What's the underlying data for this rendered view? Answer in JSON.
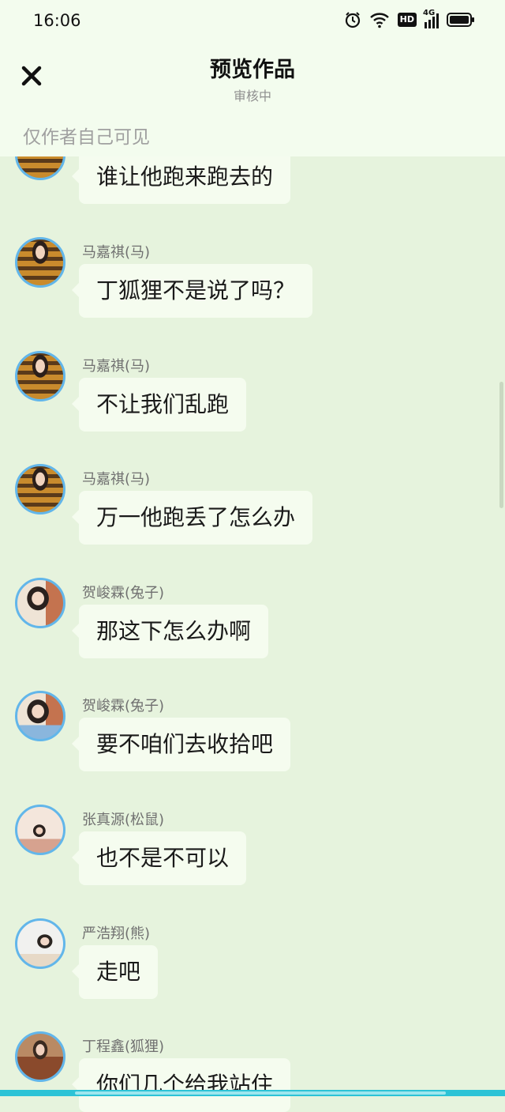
{
  "status_bar": {
    "time": "16:06",
    "hd_badge": "HD",
    "network_label": "4G"
  },
  "header": {
    "title": "预览作品",
    "subtitle": "审核中",
    "visibility_note": "仅作者自己可见",
    "close_icon": "close-icon"
  },
  "messages": [
    {
      "sender": "",
      "text": "谁让他跑来跑去的",
      "avatar": "ma"
    },
    {
      "sender": "马嘉祺(马)",
      "text": "丁狐狸不是说了吗？",
      "avatar": "ma"
    },
    {
      "sender": "马嘉祺(马)",
      "text": "不让我们乱跑",
      "avatar": "ma"
    },
    {
      "sender": "马嘉祺(马)",
      "text": "万一他跑丢了怎么办",
      "avatar": "ma"
    },
    {
      "sender": "贺峻霖(兔子)",
      "text": "那这下怎么办啊",
      "avatar": "he"
    },
    {
      "sender": "贺峻霖(兔子)",
      "text": "要不咱们去收拾吧",
      "avatar": "he"
    },
    {
      "sender": "张真源(松鼠)",
      "text": "也不是不可以",
      "avatar": "zhang"
    },
    {
      "sender": "严浩翔(熊)",
      "text": "走吧",
      "avatar": "yan"
    },
    {
      "sender": "丁程鑫(狐狸)",
      "text": "你们几个给我站住",
      "avatar": "ding"
    }
  ],
  "colors": {
    "background": "#e6f3dd",
    "bubble": "#f5fcef",
    "avatar_ring": "#62b6ea",
    "accent_bar": "#2cc3d6"
  }
}
